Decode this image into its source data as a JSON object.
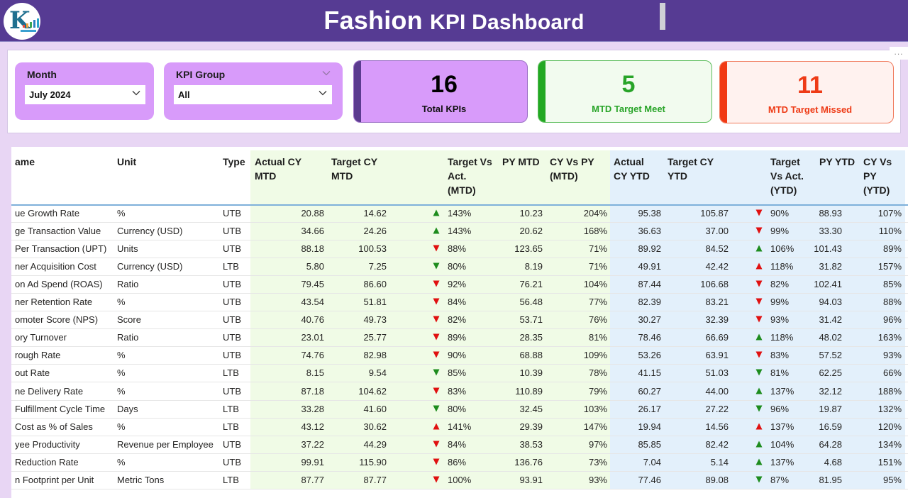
{
  "header": {
    "title_big": "Fashion",
    "title_small": "KPI Dashboard",
    "colors": {
      "header_bg": "#563b93",
      "page_bg": "#e8d6f4"
    }
  },
  "filters": {
    "month": {
      "label": "Month",
      "value": "July 2024"
    },
    "kpi_group": {
      "label": "KPI Group",
      "value": "All"
    }
  },
  "more_options": "...",
  "cards": [
    {
      "value": "16",
      "label": "Total KPIs",
      "bg": "#d89bfa",
      "accent": "#5b3b8f",
      "color": "#000000",
      "label_color": "#111111",
      "border": "#9a6fc4"
    },
    {
      "value": "5",
      "label": "MTD Target Meet",
      "bg": "#f2fbef",
      "accent": "#22a822",
      "color": "#28a428",
      "label_color": "#28a428",
      "border": "#5cbd5c"
    },
    {
      "value": "11",
      "label": "MTD Target Missed",
      "bg": "#fff2ef",
      "accent": "#f13a14",
      "color": "#ee3b16",
      "label_color": "#ee3b16",
      "border": "#f07a5c"
    }
  ],
  "table": {
    "columns": [
      "ame",
      "Unit",
      "Type",
      "Actual CY\nMTD",
      "Target CY\nMTD",
      "Target Vs\nAct.\n(MTD)",
      "PY MTD",
      "CY Vs PY\n(MTD)",
      "Actual\nCY YTD",
      "Target CY\nYTD",
      "Target\nVs Act.\n(YTD)",
      "PY YTD",
      "CY Vs\nPY\n(YTD)"
    ],
    "rows": [
      {
        "name": "ue Growth Rate",
        "unit": "%",
        "type": "UTB",
        "actual_mtd": "20.88",
        "target_mtd": "14.62",
        "mtd_icon": "up-green",
        "tva_mtd": "143%",
        "py_mtd": "10.23",
        "cyvpy_mtd": "204%",
        "actual_ytd": "95.38",
        "target_ytd": "105.87",
        "ytd_icon": "down-red",
        "tva_ytd": "90%",
        "py_ytd": "88.93",
        "cyvpy_ytd": "107%"
      },
      {
        "name": "ge Transaction Value",
        "unit": "Currency (USD)",
        "type": "UTB",
        "actual_mtd": "34.66",
        "target_mtd": "24.26",
        "mtd_icon": "up-green",
        "tva_mtd": "143%",
        "py_mtd": "20.62",
        "cyvpy_mtd": "168%",
        "actual_ytd": "36.63",
        "target_ytd": "37.00",
        "ytd_icon": "down-red",
        "tva_ytd": "99%",
        "py_ytd": "33.30",
        "cyvpy_ytd": "110%"
      },
      {
        "name": "Per Transaction (UPT)",
        "unit": "Units",
        "type": "UTB",
        "actual_mtd": "88.18",
        "target_mtd": "100.53",
        "mtd_icon": "down-red",
        "tva_mtd": "88%",
        "py_mtd": "123.65",
        "cyvpy_mtd": "71%",
        "actual_ytd": "89.92",
        "target_ytd": "84.52",
        "ytd_icon": "up-green",
        "tva_ytd": "106%",
        "py_ytd": "101.43",
        "cyvpy_ytd": "89%"
      },
      {
        "name": "ner Acquisition Cost",
        "unit": "Currency (USD)",
        "type": "LTB",
        "actual_mtd": "5.80",
        "target_mtd": "7.25",
        "mtd_icon": "down-green",
        "tva_mtd": "80%",
        "py_mtd": "8.19",
        "cyvpy_mtd": "71%",
        "actual_ytd": "49.91",
        "target_ytd": "42.42",
        "ytd_icon": "up-red",
        "tva_ytd": "118%",
        "py_ytd": "31.82",
        "cyvpy_ytd": "157%"
      },
      {
        "name": "on Ad Spend (ROAS)",
        "unit": "Ratio",
        "type": "UTB",
        "actual_mtd": "79.45",
        "target_mtd": "86.60",
        "mtd_icon": "down-red",
        "tva_mtd": "92%",
        "py_mtd": "76.21",
        "cyvpy_mtd": "104%",
        "actual_ytd": "87.44",
        "target_ytd": "106.68",
        "ytd_icon": "down-red",
        "tva_ytd": "82%",
        "py_ytd": "102.41",
        "cyvpy_ytd": "85%"
      },
      {
        "name": "ner Retention Rate",
        "unit": "%",
        "type": "UTB",
        "actual_mtd": "43.54",
        "target_mtd": "51.81",
        "mtd_icon": "down-red",
        "tva_mtd": "84%",
        "py_mtd": "56.48",
        "cyvpy_mtd": "77%",
        "actual_ytd": "82.39",
        "target_ytd": "83.21",
        "ytd_icon": "down-red",
        "tva_ytd": "99%",
        "py_ytd": "94.03",
        "cyvpy_ytd": "88%"
      },
      {
        "name": "omoter Score (NPS)",
        "unit": "Score",
        "type": "UTB",
        "actual_mtd": "40.76",
        "target_mtd": "49.73",
        "mtd_icon": "down-red",
        "tva_mtd": "82%",
        "py_mtd": "53.71",
        "cyvpy_mtd": "76%",
        "actual_ytd": "30.27",
        "target_ytd": "32.39",
        "ytd_icon": "down-red",
        "tva_ytd": "93%",
        "py_ytd": "31.42",
        "cyvpy_ytd": "96%"
      },
      {
        "name": "ory Turnover",
        "unit": "Ratio",
        "type": "UTB",
        "actual_mtd": "23.01",
        "target_mtd": "25.77",
        "mtd_icon": "down-red",
        "tva_mtd": "89%",
        "py_mtd": "28.35",
        "cyvpy_mtd": "81%",
        "actual_ytd": "78.46",
        "target_ytd": "66.69",
        "ytd_icon": "up-green",
        "tva_ytd": "118%",
        "py_ytd": "48.02",
        "cyvpy_ytd": "163%"
      },
      {
        "name": "rough Rate",
        "unit": "%",
        "type": "UTB",
        "actual_mtd": "74.76",
        "target_mtd": "82.98",
        "mtd_icon": "down-red",
        "tva_mtd": "90%",
        "py_mtd": "68.88",
        "cyvpy_mtd": "109%",
        "actual_ytd": "53.26",
        "target_ytd": "63.91",
        "ytd_icon": "down-red",
        "tva_ytd": "83%",
        "py_ytd": "57.52",
        "cyvpy_ytd": "93%"
      },
      {
        "name": "out Rate",
        "unit": "%",
        "type": "LTB",
        "actual_mtd": "8.15",
        "target_mtd": "9.54",
        "mtd_icon": "down-green",
        "tva_mtd": "85%",
        "py_mtd": "10.39",
        "cyvpy_mtd": "78%",
        "actual_ytd": "41.15",
        "target_ytd": "51.03",
        "ytd_icon": "down-green",
        "tva_ytd": "81%",
        "py_ytd": "62.25",
        "cyvpy_ytd": "66%"
      },
      {
        "name": "ne Delivery Rate",
        "unit": "%",
        "type": "UTB",
        "actual_mtd": "87.18",
        "target_mtd": "104.62",
        "mtd_icon": "down-red",
        "tva_mtd": "83%",
        "py_mtd": "110.89",
        "cyvpy_mtd": "79%",
        "actual_ytd": "60.27",
        "target_ytd": "44.00",
        "ytd_icon": "up-green",
        "tva_ytd": "137%",
        "py_ytd": "32.12",
        "cyvpy_ytd": "188%"
      },
      {
        "name": "Fulfillment Cycle Time",
        "unit": "Days",
        "type": "LTB",
        "actual_mtd": "33.28",
        "target_mtd": "41.60",
        "mtd_icon": "down-green",
        "tva_mtd": "80%",
        "py_mtd": "32.45",
        "cyvpy_mtd": "103%",
        "actual_ytd": "26.17",
        "target_ytd": "27.22",
        "ytd_icon": "down-green",
        "tva_ytd": "96%",
        "py_ytd": "19.87",
        "cyvpy_ytd": "132%"
      },
      {
        "name": "Cost as % of Sales",
        "unit": "%",
        "type": "LTB",
        "actual_mtd": "43.12",
        "target_mtd": "30.62",
        "mtd_icon": "up-red",
        "tva_mtd": "141%",
        "py_mtd": "29.39",
        "cyvpy_mtd": "147%",
        "actual_ytd": "19.94",
        "target_ytd": "14.56",
        "ytd_icon": "up-red",
        "tva_ytd": "137%",
        "py_ytd": "16.59",
        "cyvpy_ytd": "120%"
      },
      {
        "name": "yee Productivity",
        "unit": "Revenue per Employee",
        "type": "UTB",
        "actual_mtd": "37.22",
        "target_mtd": "44.29",
        "mtd_icon": "down-red",
        "tva_mtd": "84%",
        "py_mtd": "38.53",
        "cyvpy_mtd": "97%",
        "actual_ytd": "85.85",
        "target_ytd": "82.42",
        "ytd_icon": "up-green",
        "tva_ytd": "104%",
        "py_ytd": "64.28",
        "cyvpy_ytd": "134%"
      },
      {
        "name": "Reduction Rate",
        "unit": "%",
        "type": "UTB",
        "actual_mtd": "99.91",
        "target_mtd": "115.90",
        "mtd_icon": "down-red",
        "tva_mtd": "86%",
        "py_mtd": "136.76",
        "cyvpy_mtd": "73%",
        "actual_ytd": "7.04",
        "target_ytd": "5.14",
        "ytd_icon": "up-green",
        "tva_ytd": "137%",
        "py_ytd": "4.68",
        "cyvpy_ytd": "151%"
      },
      {
        "name": "n Footprint per Unit",
        "unit": "Metric Tons",
        "type": "LTB",
        "actual_mtd": "87.77",
        "target_mtd": "87.77",
        "mtd_icon": "down-red",
        "tva_mtd": "100%",
        "py_mtd": "93.91",
        "cyvpy_mtd": "93%",
        "actual_ytd": "77.46",
        "target_ytd": "89.08",
        "ytd_icon": "down-green",
        "tva_ytd": "87%",
        "py_ytd": "81.95",
        "cyvpy_ytd": "95%"
      }
    ]
  },
  "icon_colors": {
    "green": "#1e8c1e",
    "red": "#e01010"
  }
}
